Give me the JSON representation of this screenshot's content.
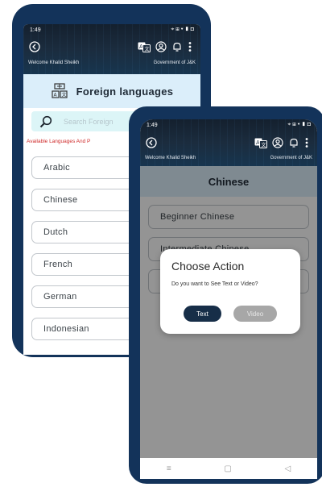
{
  "colors": {
    "frame": "#13335a",
    "accent_red": "#cf2b2b",
    "dialog_btn_dark": "#172e48",
    "dialog_btn_disabled": "#a7a7a7"
  },
  "phone1": {
    "status": {
      "time": "1:49",
      "right": "⌖ ⊞ ▾ ▮ ◘"
    },
    "appbar": {
      "welcome": "Welcome Khalid Sheikh",
      "gov": "Government of J&K"
    },
    "header": {
      "title": "Foreign languages",
      "icon": "language-icon"
    },
    "search": {
      "placeholder": "Search Foreign"
    },
    "available_label": "Available Languages And P",
    "languages": [
      "Arabic",
      "Chinese",
      "Dutch",
      "French",
      "German",
      "Indonesian"
    ]
  },
  "phone2": {
    "status": {
      "time": "1:49",
      "right": "⌖ ⊞ ▾ ▮ ◘"
    },
    "appbar": {
      "welcome": "Welcome Khalid Sheikh",
      "gov": "Government of J&K"
    },
    "title": "Chinese",
    "levels": [
      "Beginner Chinese",
      "Intermediate Chinese",
      ""
    ],
    "dialog": {
      "title": "Choose Action",
      "message": "Do you want to See Text or Video?",
      "text_button": "Text",
      "video_button": "Video"
    },
    "navbar": {
      "menu": "≡",
      "home": "▢",
      "back": "◁"
    }
  }
}
